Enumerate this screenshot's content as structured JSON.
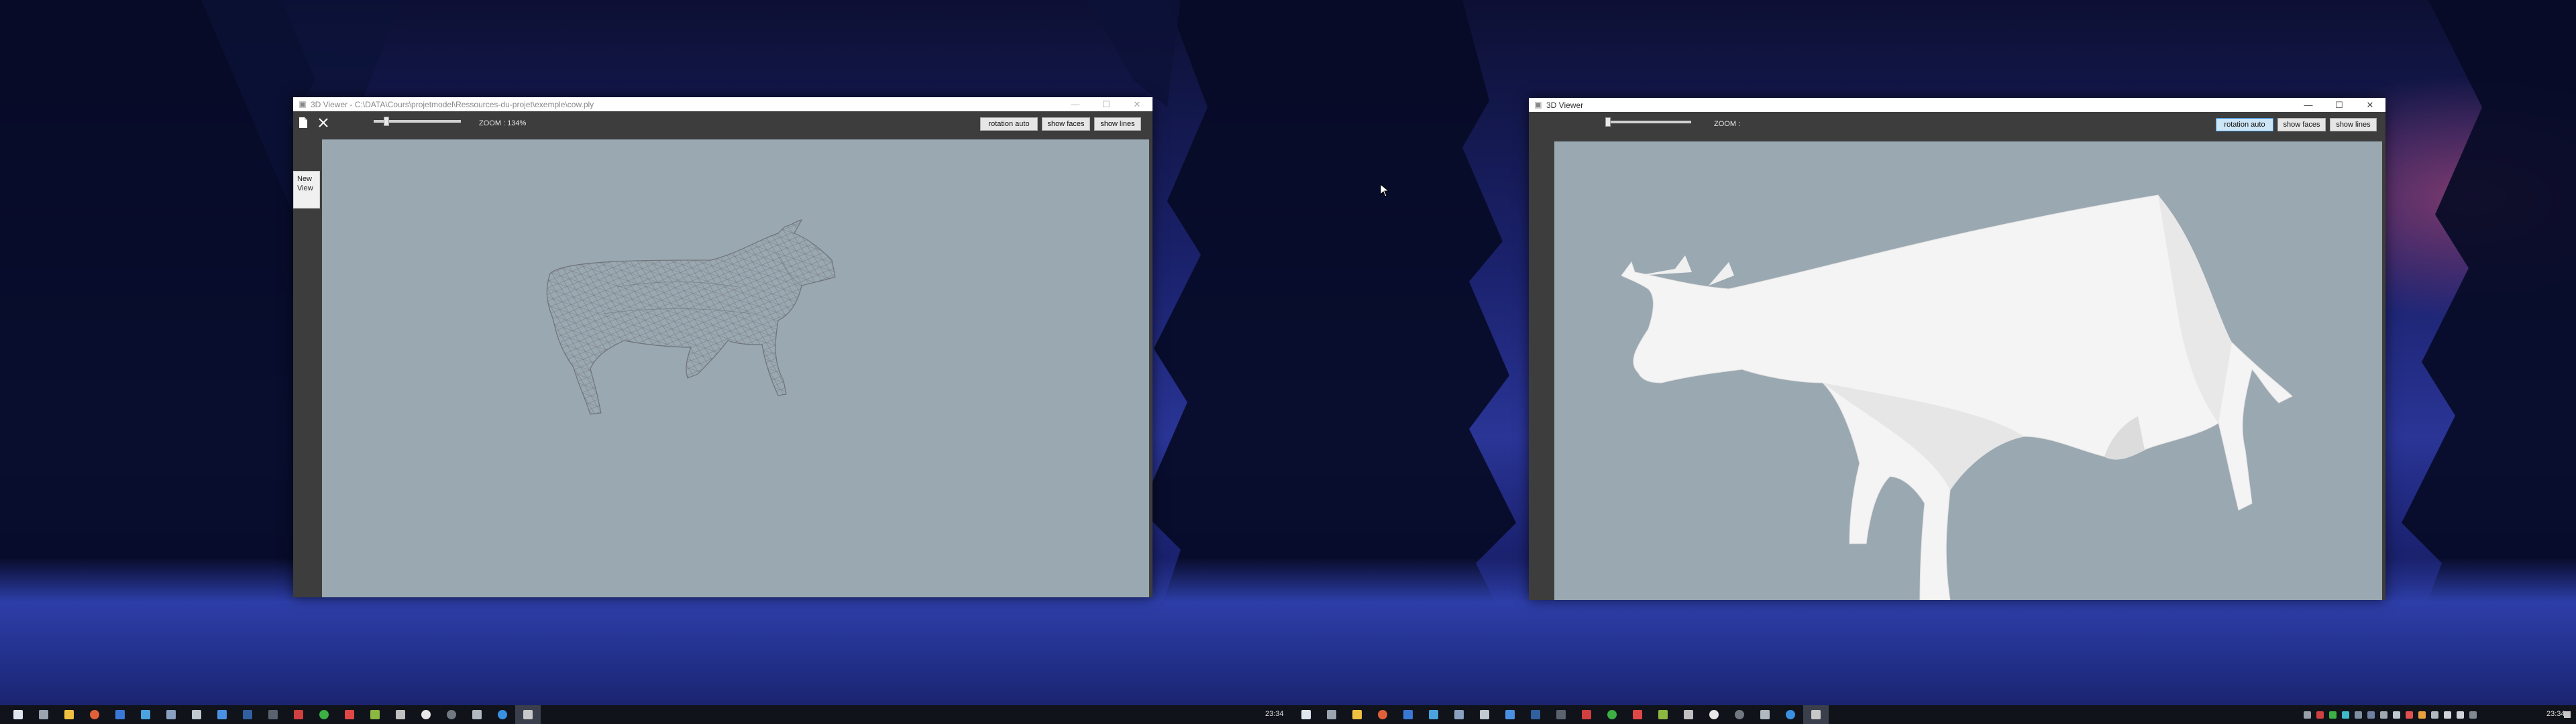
{
  "left_window": {
    "title": "3D Viewer - C:\\DATA\\Cours\\projetmodel\\Ressources-du-projet\\exemple\\cow.ply",
    "zoom_label": "ZOOM : 134%",
    "slider_value": 0.12,
    "buttons": {
      "rotation": "rotation auto",
      "faces": "show faces",
      "lines": "show lines"
    },
    "side_button": "New View",
    "render_mode": "wireframe"
  },
  "right_window": {
    "title": "3D Viewer",
    "zoom_label": "ZOOM :",
    "slider_value": 0.0,
    "buttons": {
      "rotation": "rotation auto",
      "faces": "show faces",
      "lines": "show lines"
    },
    "render_mode": "faces"
  },
  "window_controls": {
    "minimize": "—",
    "maximize": "☐",
    "close": "✕"
  },
  "taskbar_left": {
    "clock": "23:34"
  },
  "taskbar_right": {
    "clock": "23:34"
  },
  "icons": {
    "file": "file-icon",
    "close": "close-icon",
    "start": "windows-start-icon"
  },
  "colors": {
    "viewport": "#9aa8b1",
    "window_dark": "#3d3d3d",
    "taskbar": "#101319",
    "active_button": "#cde6f7"
  }
}
